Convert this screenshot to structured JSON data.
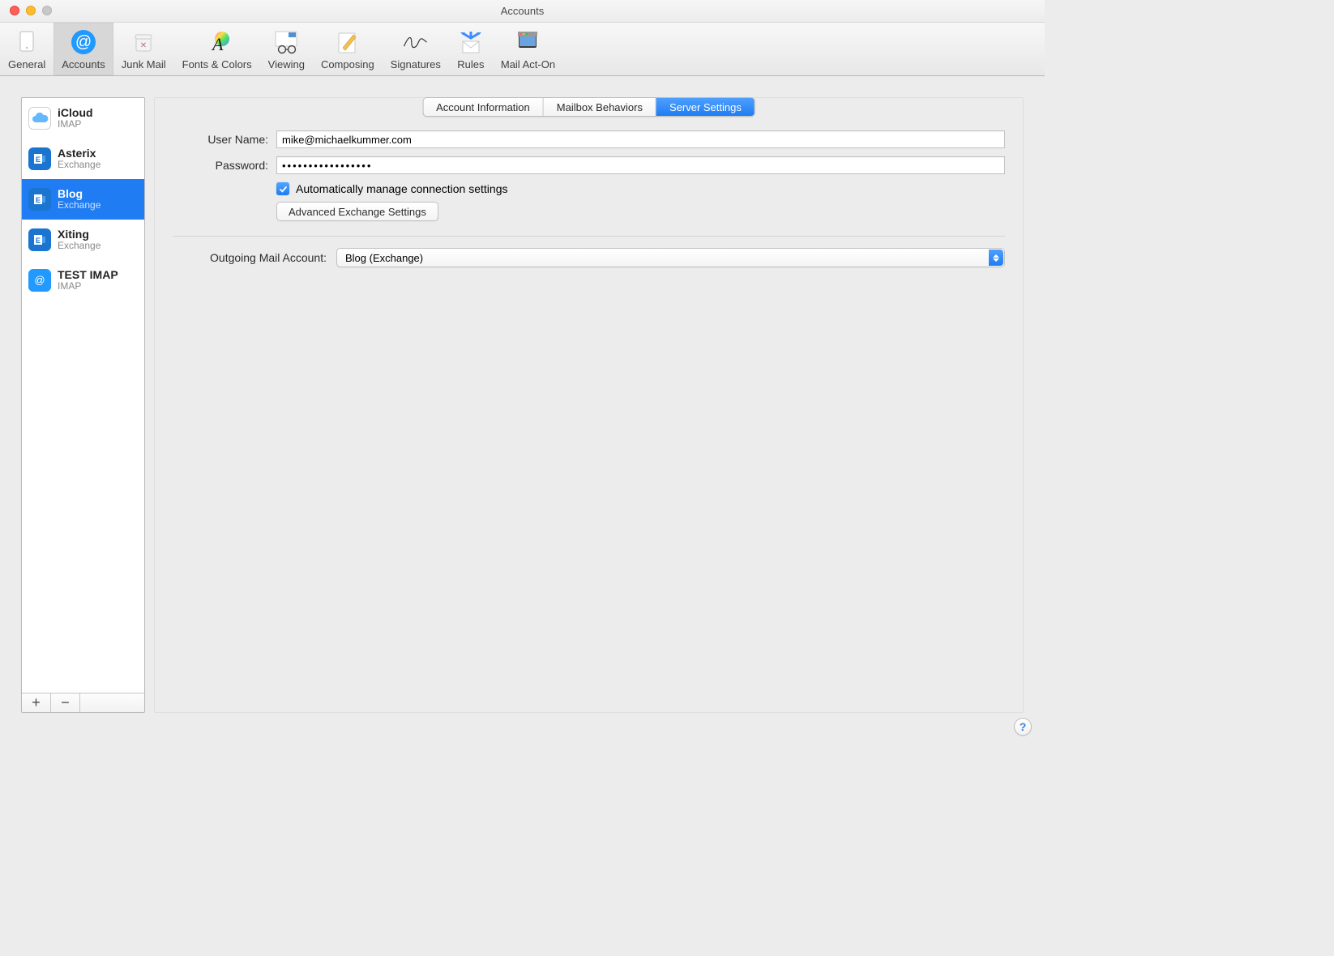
{
  "window": {
    "title": "Accounts"
  },
  "toolbar": {
    "items": [
      {
        "id": "general",
        "label": "General"
      },
      {
        "id": "accounts",
        "label": "Accounts",
        "selected": true
      },
      {
        "id": "junk",
        "label": "Junk Mail"
      },
      {
        "id": "fonts",
        "label": "Fonts & Colors"
      },
      {
        "id": "viewing",
        "label": "Viewing"
      },
      {
        "id": "composing",
        "label": "Composing"
      },
      {
        "id": "signatures",
        "label": "Signatures"
      },
      {
        "id": "rules",
        "label": "Rules"
      },
      {
        "id": "mail-act-on",
        "label": "Mail Act-On"
      }
    ]
  },
  "accounts": [
    {
      "name": "iCloud",
      "type": "IMAP",
      "kind": "icloud"
    },
    {
      "name": "Asterix",
      "type": "Exchange",
      "kind": "exchange"
    },
    {
      "name": "Blog",
      "type": "Exchange",
      "kind": "exchange",
      "selected": true
    },
    {
      "name": "Xiting",
      "type": "Exchange",
      "kind": "exchange"
    },
    {
      "name": "TEST IMAP",
      "type": "IMAP",
      "kind": "at"
    }
  ],
  "list_footer": {
    "add": "+",
    "remove": "−"
  },
  "tabs": {
    "account_info": "Account Information",
    "mailbox_behaviors": "Mailbox Behaviors",
    "server_settings": "Server Settings"
  },
  "form": {
    "user_name_label": "User Name:",
    "user_name_value": "mike@michaelkummer.com",
    "password_label": "Password:",
    "password_value": "•••••••••••••••••",
    "auto_manage_label": "Automatically manage connection settings",
    "auto_manage_checked": true,
    "advanced_button": "Advanced Exchange Settings",
    "outgoing_label": "Outgoing Mail Account:",
    "outgoing_value": "Blog (Exchange)"
  },
  "help_button": "?"
}
